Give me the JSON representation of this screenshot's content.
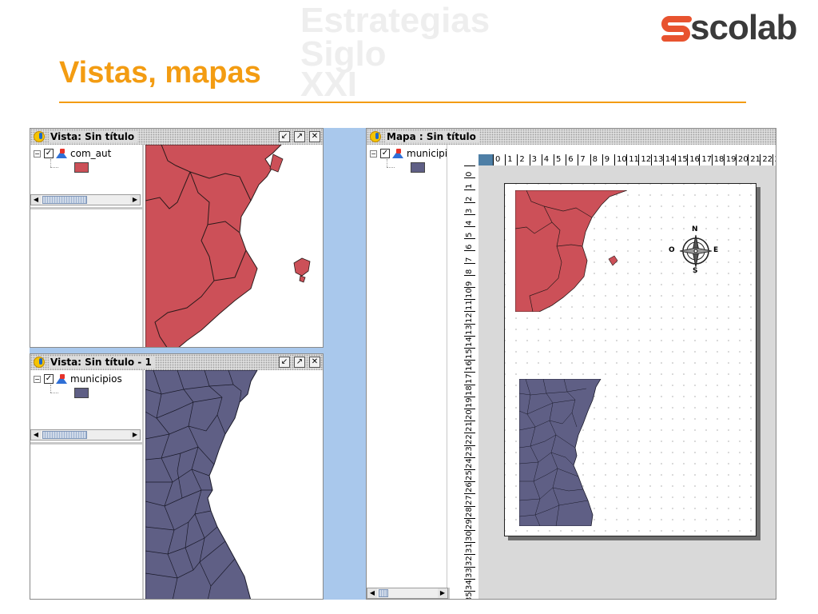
{
  "slide": {
    "title": "Vistas, mapas",
    "brand": "scolab",
    "watermark": [
      "Estrategias",
      "Siglo",
      "XXI"
    ],
    "accent_color": "#f39c12"
  },
  "windows": {
    "view1": {
      "title": "Vista: Sin título",
      "layer": "com_aut",
      "layer_color": "#cc5058",
      "checked": "✓",
      "toggle": "−"
    },
    "view2": {
      "title": "Vista: Sin título - 1",
      "layer": "municipios",
      "layer_color": "#5f5f85",
      "checked": "✓",
      "toggle": "−"
    },
    "layout": {
      "title": "Mapa : Sin título",
      "layer": "municipi",
      "checked": "✓",
      "toggle": "−",
      "ruler_h": [
        "0",
        "1",
        "2",
        "3",
        "4",
        "5",
        "6",
        "7",
        "8",
        "9",
        "10",
        "11",
        "12",
        "13",
        "14",
        "15",
        "16",
        "17",
        "18",
        "19",
        "20",
        "21",
        "22",
        "23"
      ],
      "ruler_v": [
        "0",
        "1",
        "2",
        "3",
        "4",
        "5",
        "6",
        "7",
        "8",
        "9",
        "10",
        "11",
        "12",
        "13",
        "14",
        "15",
        "16",
        "17",
        "18",
        "19",
        "20",
        "21",
        "22",
        "23",
        "24",
        "25",
        "26",
        "27",
        "28",
        "29",
        "30",
        "31",
        "32",
        "33",
        "34",
        "35"
      ],
      "north_arrow": {
        "n": "N",
        "s": "S",
        "e": "E",
        "w": "O"
      }
    }
  },
  "icons": {
    "minimize": "minimize-icon",
    "maximize": "maximize-icon",
    "close": "close-icon",
    "scroll_left": "◀",
    "scroll_right": "▶",
    "close_glyph": "✕"
  }
}
